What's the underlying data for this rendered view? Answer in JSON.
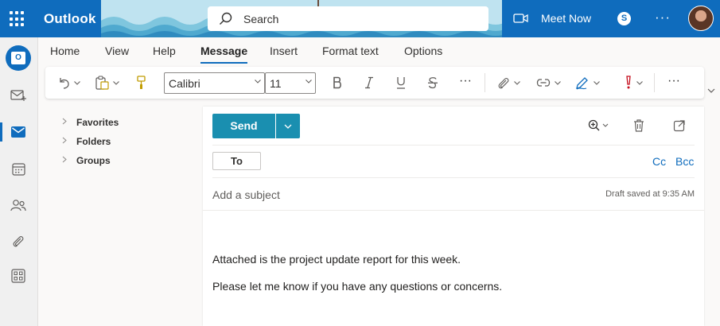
{
  "header": {
    "app_name": "Outlook",
    "search_placeholder": "Search",
    "meet_now_label": "Meet Now",
    "skype_label": "S",
    "more_label": "···",
    "brand_color": "#0f6cbd"
  },
  "rail": {
    "items": [
      {
        "name": "new-mail",
        "icon": "compose-mail-icon"
      },
      {
        "name": "mail",
        "icon": "mail-icon",
        "active": true
      },
      {
        "name": "calendar",
        "icon": "calendar-icon"
      },
      {
        "name": "people",
        "icon": "people-icon"
      },
      {
        "name": "files",
        "icon": "paperclip-icon"
      },
      {
        "name": "apps",
        "icon": "apps-icon"
      }
    ]
  },
  "ribbon": {
    "tabs": [
      "Home",
      "View",
      "Help",
      "Message",
      "Insert",
      "Format text",
      "Options"
    ],
    "active_tab": "Message",
    "font_name": "Calibri",
    "font_size": "11",
    "more_label": "···"
  },
  "folders": [
    {
      "label": "Favorites"
    },
    {
      "label": "Folders"
    },
    {
      "label": "Groups"
    }
  ],
  "compose": {
    "send_label": "Send",
    "to_label": "To",
    "cc_label": "Cc",
    "bcc_label": "Bcc",
    "subject_placeholder": "Add a subject",
    "draft_status": "Draft saved at 9:35 AM",
    "body": [
      "Attached is the project update report for this week.",
      "Please let me know if you have any questions or concerns."
    ]
  }
}
